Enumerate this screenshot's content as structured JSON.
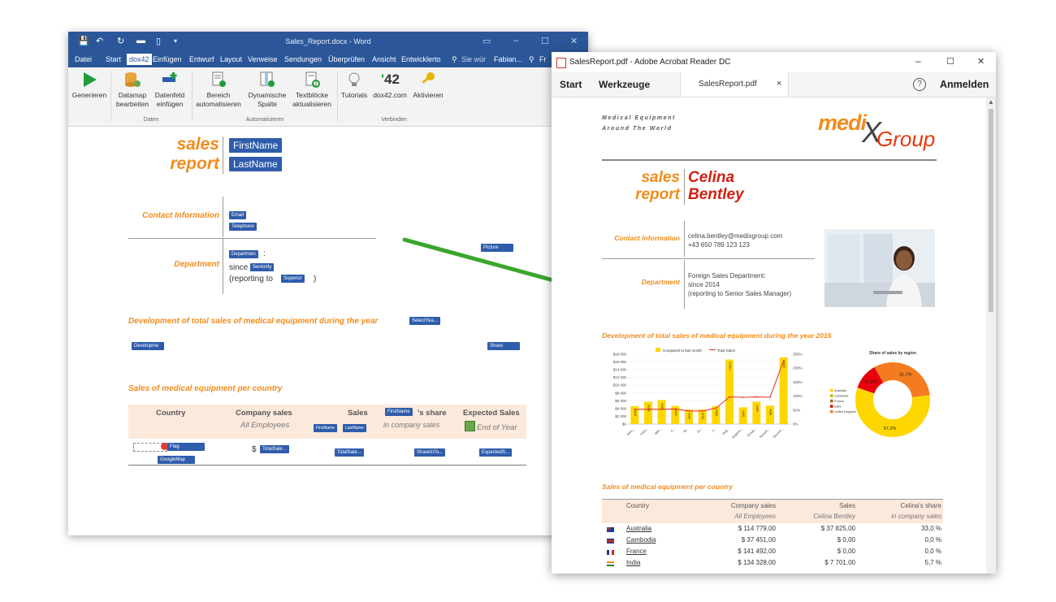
{
  "word": {
    "title": "Sales_Report.docx - Word",
    "tabs": [
      "Datei",
      "Start",
      "dox42",
      "Einfügen",
      "Entwurf",
      "Layout",
      "Verweise",
      "Sendungen",
      "Überprüfen",
      "Ansicht",
      "Entwicklerto",
      "Sie wür",
      "Fabian...",
      "Fr"
    ],
    "ribbon": {
      "buttons": [
        {
          "label1": "Generieren",
          "label2": "",
          "icon": "play-icon"
        },
        {
          "label1": "Datamap",
          "label2": "bearbeiten",
          "icon": "database-edit-icon"
        },
        {
          "label1": "Datenfeld",
          "label2": "einfügen",
          "icon": "insert-field-icon"
        },
        {
          "label1": "Bereich",
          "label2": "automatisieren",
          "icon": "automate-region-icon"
        },
        {
          "label1": "Dynamische",
          "label2": "Spalte",
          "icon": "dynamic-column-icon"
        },
        {
          "label1": "Textblöcke",
          "label2": "aktualisieren",
          "icon": "refresh-textblocks-icon"
        },
        {
          "label1": "Tutorials",
          "label2": "",
          "icon": "lightbulb-icon"
        },
        {
          "label1": "dox42.com",
          "label2": "",
          "icon": "dox42-logo-icon"
        },
        {
          "label1": "Aktivieren",
          "label2": "",
          "icon": "key-icon"
        }
      ],
      "groups": [
        "Daten",
        "Automatisieren",
        "Verbinden"
      ],
      "logo_text": "42"
    },
    "doc": {
      "sales": "sales",
      "report": "report",
      "firstname": "FirstName",
      "lastname": "LastName",
      "contact_label": "Contact Information",
      "email": "Email",
      "telephone": "Telephone",
      "department_label": "Department",
      "department_ctrl": "Departmen",
      "colon": ":",
      "since": "since",
      "seniority": "Seniority",
      "reporting_open": "(reporting to",
      "superior": "Superior",
      "reporting_close": ")",
      "picture": "Picture",
      "dev_heading": "Development of total sales of medical equipment during the year",
      "select_year": "SelectYea...",
      "development": "Developme",
      "share": "Share",
      "sales_heading": "Sales of medical equipment per country",
      "table_headers": {
        "country": "Country",
        "company_sales": "Company sales",
        "all_employees": "All Employees",
        "sales": "Sales",
        "firstname_small": "FirstName",
        "lastname_small": "LastName",
        "share_suffix": "'s share",
        "firstname_share": "FirstName",
        "in_company_sales": "in company sales",
        "expected_sales": "Expected Sales",
        "end_of_year": "End of Year"
      },
      "row": {
        "flag": "Flag",
        "google_map": "GoogleMap",
        "dollar": "$",
        "total_sales1": "TotalSale...",
        "total_sales2": "TotalSale...",
        "share_in_to": "ShareInTo...",
        "expected": "ExpectedS..."
      }
    }
  },
  "acrobat": {
    "title": "SalesReport.pdf - Adobe Acrobat Reader DC",
    "tabs": {
      "start": "Start",
      "tools": "Werkzeuge",
      "file": "SalesReport.pdf",
      "close": "×"
    },
    "help": "?",
    "signin": "Anmelden",
    "window_controls": {
      "min": "–",
      "max": "☐",
      "close": "✕"
    },
    "pdf": {
      "tagline1": "Medical Equipment",
      "tagline2": "Around The World",
      "logo_medi": "medi",
      "logo_x": "X",
      "logo_group": "Group",
      "sales": "sales",
      "report": "report",
      "first_name": "Celina",
      "last_name": "Bentley",
      "contact_label": "Contact Information",
      "email": "celina.bentley@medixgroup.com",
      "phone": "+43 650 789 123 123",
      "department_label": "Department",
      "department": "Foreign Sales Department:",
      "since": "since 2014",
      "reporting": "(reporting to Senior Sales Manager)",
      "dev_heading": "Development of total sales of medical equipment during the year 2016",
      "sales_heading": "Sales of medical equipment per country",
      "table_headers": {
        "country": "Country",
        "company_sales": "Company sales",
        "all_employees": "All Employees",
        "sales": "Sales",
        "celina_bentley": "Celina Bentley",
        "share": "Celina's share",
        "in_company_sales": "in company sales"
      },
      "rows": [
        {
          "country": "Australia",
          "company_sales": "$ 114 779,00",
          "sales": "$ 37 825,00",
          "share": "33,0 %",
          "flag": "au"
        },
        {
          "country": "Cambodia",
          "company_sales": "$ 37 451,00",
          "sales": "$ 0,00",
          "share": "0,0 %",
          "flag": "kh"
        },
        {
          "country": "France",
          "company_sales": "$ 141 492,00",
          "sales": "$ 0,00",
          "share": "0,0 %",
          "flag": "fr"
        },
        {
          "country": "India",
          "company_sales": "$ 134 328,00",
          "sales": "$ 7 701,00",
          "share": "5,7 %",
          "flag": "in"
        }
      ]
    }
  },
  "chart_data": [
    {
      "type": "bar",
      "title": "",
      "categories": [
        "Janu...",
        "Febr...",
        "Mar...",
        "A...",
        "M...",
        "Ju...",
        "J...",
        "Aug...",
        "Septem...",
        "Octob...",
        "Novem...",
        "Decem..."
      ],
      "series": [
        {
          "name": "Compared to last month",
          "values": [
            0.64,
            0.8,
            0.86,
            0.65,
            0.52,
            0.52,
            0.64,
            2.31,
            0.6,
            0.8,
            0.66,
            2.39
          ]
        },
        {
          "name": "Total Sales",
          "values": [
            3800,
            3800,
            3800,
            3900,
            3400,
            3400,
            4100,
            7000,
            6900,
            7000,
            6900,
            16300
          ]
        }
      ],
      "data_labels": [
        "64%",
        "80%",
        "86%",
        "65%",
        "52%",
        "52%",
        "64%",
        "231%",
        "60%",
        "80%",
        "66%",
        "239%"
      ],
      "y_ticks": [
        "$18 000",
        "$16 000",
        "$14 000",
        "$12 000",
        "$10 000",
        "$8 000",
        "$6 000",
        "$4 000",
        "$2 000",
        "$0"
      ],
      "y2_ticks": [
        "250%",
        "200%",
        "150%",
        "100%",
        "50%",
        "0%"
      ],
      "ylim": [
        0,
        18000
      ],
      "y2lim": [
        0,
        2.5
      ],
      "colors": {
        "bar": "#ffd700",
        "line": "#e53935"
      },
      "legend": "top"
    },
    {
      "type": "pie",
      "title": "Share of sales by region",
      "labels": [
        "Australia",
        "Cambodia",
        "France",
        "India",
        "United Kingdom"
      ],
      "values": [
        57.2,
        0.0,
        0.0,
        11.6,
        31.1
      ],
      "data_labels": [
        "57,2%",
        "11,6%",
        "31,1%"
      ],
      "colors": [
        "#ffd700",
        "#c9b400",
        "#a06d00",
        "#e8000d",
        "#f47b20"
      ],
      "legend": "left"
    }
  ],
  "arrow": {
    "color": "#3aa62c"
  }
}
